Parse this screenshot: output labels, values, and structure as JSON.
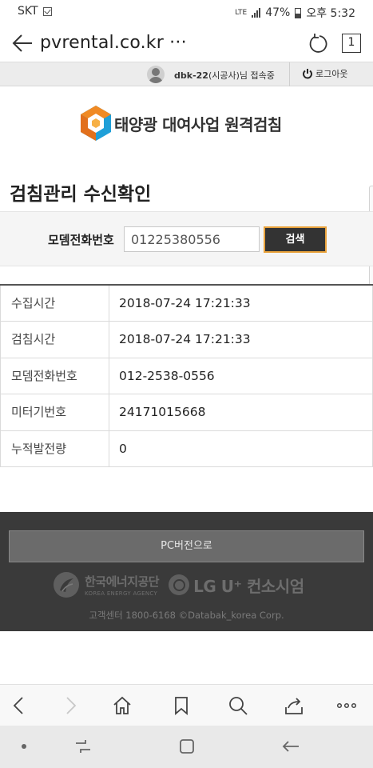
{
  "status_bar": {
    "carrier": "SKT",
    "network": "LTE",
    "battery": "47%",
    "time": "오후 5:32"
  },
  "browser": {
    "url": "pvrental.co.kr ···",
    "tab_count": "1"
  },
  "session": {
    "user_id": "dbk-22",
    "user_suffix": "(시공사)님 접속중",
    "logout_label": "로그아웃"
  },
  "logo": {
    "text": "태양광 대여사업 원격검침"
  },
  "page": {
    "title": "검침관리 수신확인"
  },
  "search": {
    "label": "모뎀전화번호",
    "value": "01225380556",
    "button_label": "검색"
  },
  "info_rows": [
    {
      "key": "수집시간",
      "value": "2018-07-24 17:21:33"
    },
    {
      "key": "검침시간",
      "value": "2018-07-24 17:21:33"
    },
    {
      "key": "모뎀전화번호",
      "value": "012-2538-0556"
    },
    {
      "key": "미터기번호",
      "value": "24171015668"
    },
    {
      "key": "누적발전량",
      "value": "0"
    }
  ],
  "footer": {
    "pc_version_label": "PC버전으로",
    "energy_agency_ko": "한국에너지공단",
    "energy_agency_en": "KOREA ENERGY AGENCY",
    "lg_consortium": "LG U⁺ 컨소시엄",
    "copyright": "고객센터 1800-6168 ©Databak_korea Corp."
  },
  "colors": {
    "search_button_bg": "#333333",
    "search_button_border": "#e9a23b",
    "footer_bg": "#3a3a3a",
    "logo_orange": "#f08a24",
    "logo_blue": "#1f9fd8"
  },
  "icons": {
    "toolbar": [
      "back-icon",
      "forward-icon",
      "home-icon",
      "bookmark-icon",
      "search-icon",
      "share-icon",
      "more-icon"
    ],
    "navbar": [
      "dot-icon",
      "recent-apps-icon",
      "home-square-icon",
      "back-arrow-icon"
    ]
  }
}
